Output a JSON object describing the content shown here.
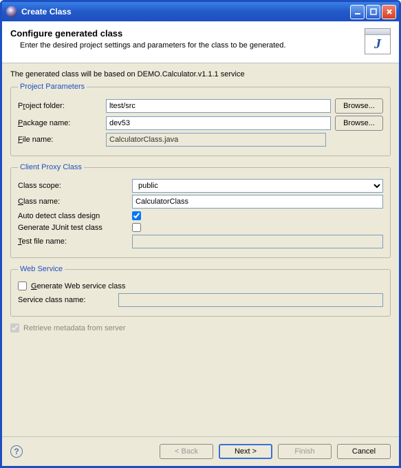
{
  "window": {
    "title": "Create Class"
  },
  "header": {
    "title": "Configure generated class",
    "subtitle": "Enter the desired project settings and parameters for the class to be generated."
  },
  "info_line": "The generated class will be based on DEMO.Calculator.v1.1.1 service",
  "project": {
    "legend": "Project Parameters",
    "folder_label_pre": "P",
    "folder_label_u": "r",
    "folder_label_post": "oject folder:",
    "folder_value": "ltest/src",
    "package_label_pre": "",
    "package_label_u": "P",
    "package_label_post": "ackage name:",
    "package_value": "dev53",
    "file_label_pre": "",
    "file_label_u": "F",
    "file_label_post": "ile name:",
    "file_value": "CalculatorClass.java",
    "browse": "Browse..."
  },
  "proxy": {
    "legend": "Client Proxy Class",
    "scope_label": "Class scope:",
    "scope_value": "public",
    "name_label_pre": "",
    "name_label_u": "C",
    "name_label_post": "lass name:",
    "name_value": "CalculatorClass",
    "auto_label": "Auto detect class design",
    "auto_checked": true,
    "junit_label": "Generate JUnit test class",
    "junit_checked": false,
    "testfile_label_pre": "",
    "testfile_label_u": "T",
    "testfile_label_post": "est file name:",
    "testfile_value": ""
  },
  "ws": {
    "legend": "Web Service",
    "gen_label_pre": "",
    "gen_label_u": "G",
    "gen_label_post": "enerate Web service class",
    "gen_checked": false,
    "svc_label": "Service class name:",
    "svc_value": ""
  },
  "retrieve": {
    "label": "Retrieve metadata from server",
    "checked": true
  },
  "buttons": {
    "back": "< Back",
    "next": "Next >",
    "finish": "Finish",
    "cancel": "Cancel"
  }
}
